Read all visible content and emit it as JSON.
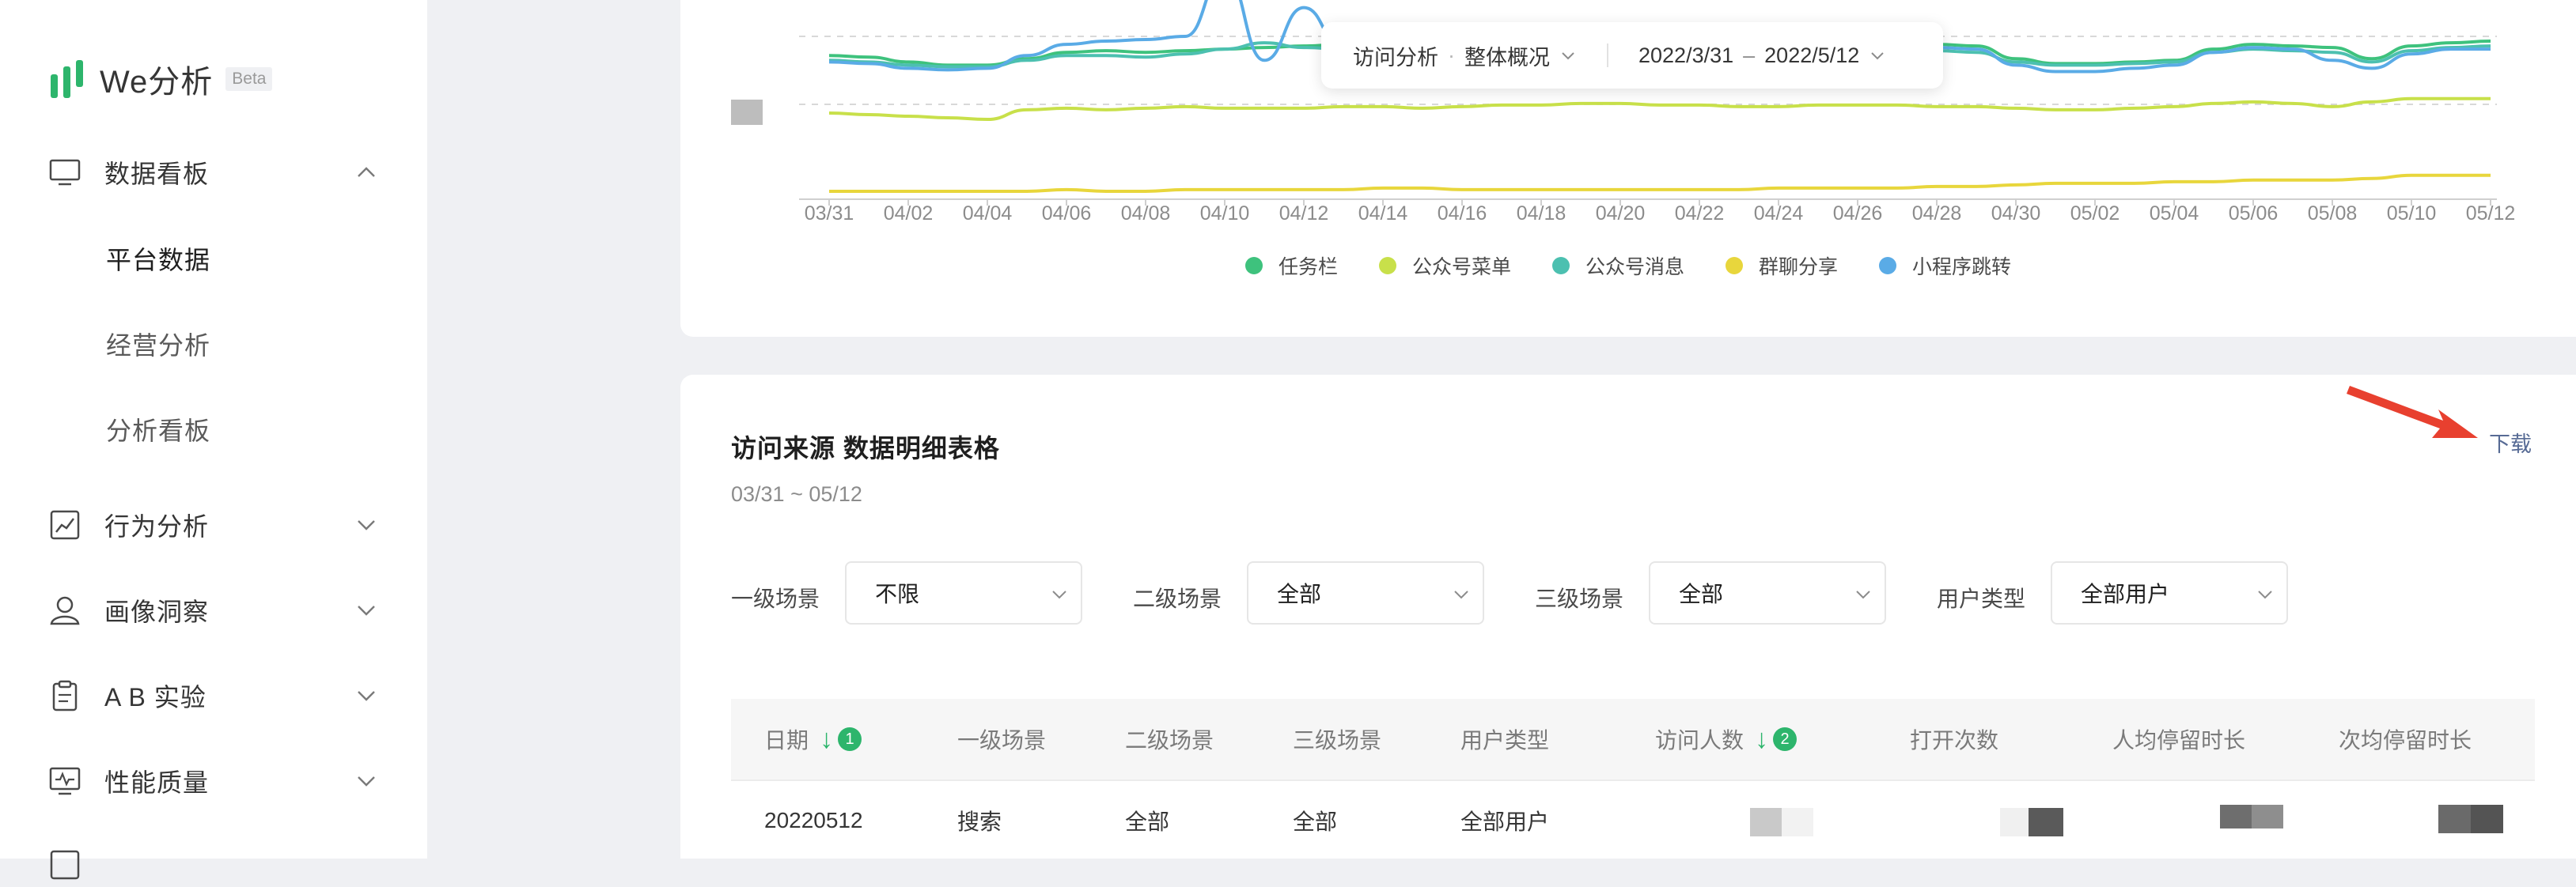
{
  "sidebar": {
    "brand": {
      "name": "We分析",
      "badge": "Beta",
      "color": "#2db56c"
    },
    "menu": [
      {
        "label": "数据看板",
        "icon": "monitor-icon",
        "expanded": true
      },
      {
        "label": "行为分析",
        "icon": "line-chart-icon",
        "expanded": false
      },
      {
        "label": "画像洞察",
        "icon": "user-portrait-icon",
        "expanded": false
      },
      {
        "label": "A B 实验",
        "icon": "clipboard-icon",
        "expanded": false
      },
      {
        "label": "性能质量",
        "icon": "performance-monitor-icon",
        "expanded": false
      }
    ],
    "submenu": [
      {
        "label": "平台数据",
        "active": true
      },
      {
        "label": "经营分析",
        "active": false
      },
      {
        "label": "分析看板",
        "active": false
      }
    ]
  },
  "float_bar": {
    "metric": "访问分析",
    "scope": "整体概况",
    "date_start": "2022/3/31",
    "date_sep": "–",
    "date_end": "2022/5/12"
  },
  "chart_data": {
    "type": "line",
    "x": [
      "03/31",
      "04/01",
      "04/02",
      "04/03",
      "04/04",
      "04/05",
      "04/06",
      "04/07",
      "04/08",
      "04/09",
      "04/10",
      "04/11",
      "04/12",
      "04/13",
      "04/14",
      "04/15",
      "04/16",
      "04/17",
      "04/18",
      "04/19",
      "04/20",
      "04/21",
      "04/22",
      "04/23",
      "04/24",
      "04/25",
      "04/26",
      "04/27",
      "04/28",
      "04/29",
      "04/30",
      "05/01",
      "05/02",
      "05/03",
      "05/04",
      "05/05",
      "05/06",
      "05/07",
      "05/08",
      "05/09",
      "05/10",
      "05/11",
      "05/12"
    ],
    "tick_labels": [
      "03/31",
      "04/02",
      "04/04",
      "04/06",
      "04/08",
      "04/10",
      "04/12",
      "04/14",
      "04/16",
      "04/18",
      "04/20",
      "04/22",
      "04/24",
      "04/26",
      "04/28",
      "04/30",
      "05/02",
      "05/04",
      "05/06",
      "05/08",
      "05/10",
      "05/12"
    ],
    "series": [
      {
        "name": "任务栏",
        "color": "#3ec27d",
        "values": [
          88,
          87,
          84,
          82,
          82,
          86,
          90,
          91,
          90,
          91,
          92,
          93,
          94,
          95,
          95,
          94,
          95,
          96,
          96,
          96,
          96,
          95,
          95,
          95,
          96,
          96,
          96,
          95,
          95,
          94,
          86,
          83,
          83,
          84,
          85,
          92,
          95,
          94,
          93,
          86,
          94,
          96,
          97
        ]
      },
      {
        "name": "公众号菜单",
        "color": "#c8e04a",
        "values": [
          52,
          51,
          50,
          49,
          48,
          54,
          55,
          54,
          55,
          56,
          55,
          55,
          55,
          56,
          56,
          55,
          56,
          57,
          57,
          58,
          58,
          57,
          57,
          56,
          56,
          57,
          57,
          57,
          56,
          56,
          55,
          54,
          54,
          55,
          56,
          58,
          59,
          58,
          56,
          59,
          61,
          61,
          61
        ]
      },
      {
        "name": "公众号消息",
        "color": "#4cc0b0",
        "values": [
          85,
          84,
          82,
          81,
          81,
          85,
          88,
          88,
          87,
          89,
          92,
          96,
          93,
          92,
          92,
          91,
          92,
          93,
          93,
          93,
          94,
          93,
          93,
          93,
          93,
          92,
          92,
          91,
          91,
          90,
          84,
          82,
          82,
          83,
          84,
          90,
          92,
          91,
          90,
          84,
          91,
          93,
          94
        ]
      },
      {
        "name": "群聊分享",
        "color": "#e8d63c",
        "values": [
          3,
          3,
          3,
          3,
          3,
          3,
          4,
          3,
          3,
          4,
          4,
          4,
          4,
          4,
          5,
          5,
          4,
          4,
          4,
          4,
          4,
          4,
          4,
          4,
          5,
          5,
          5,
          5,
          6,
          6,
          7,
          8,
          8,
          8,
          9,
          9,
          10,
          10,
          10,
          11,
          13,
          13,
          13
        ]
      },
      {
        "name": "小程序跳转",
        "color": "#5aabe6",
        "values": [
          84,
          83,
          80,
          79,
          80,
          88,
          95,
          97,
          98,
          100,
          140,
          85,
          118,
          92,
          94,
          92,
          94,
          95,
          94,
          95,
          96,
          95,
          94,
          94,
          94,
          94,
          94,
          93,
          93,
          92,
          82,
          78,
          78,
          80,
          82,
          90,
          93,
          92,
          85,
          80,
          89,
          92,
          92
        ]
      }
    ],
    "legend_position": "bottom",
    "grid": "dashed-horizontal"
  },
  "table": {
    "title": "访问来源 数据明细表格",
    "range": "03/31 ~ 05/12",
    "download": "下载",
    "filters": [
      {
        "label": "一级场景",
        "value": "不限"
      },
      {
        "label": "二级场景",
        "value": "全部"
      },
      {
        "label": "三级场景",
        "value": "全部"
      },
      {
        "label": "用户类型",
        "value": "全部用户"
      }
    ],
    "columns": [
      {
        "label": "日期",
        "sort_index": "1"
      },
      {
        "label": "一级场景"
      },
      {
        "label": "二级场景"
      },
      {
        "label": "三级场景"
      },
      {
        "label": "用户类型"
      },
      {
        "label": "访问人数",
        "sort_index": "2"
      },
      {
        "label": "打开次数"
      },
      {
        "label": "人均停留时长"
      },
      {
        "label": "次均停留时长"
      }
    ],
    "rows": [
      [
        "20220512",
        "搜索",
        "全部",
        "全部",
        "全部用户"
      ]
    ]
  }
}
